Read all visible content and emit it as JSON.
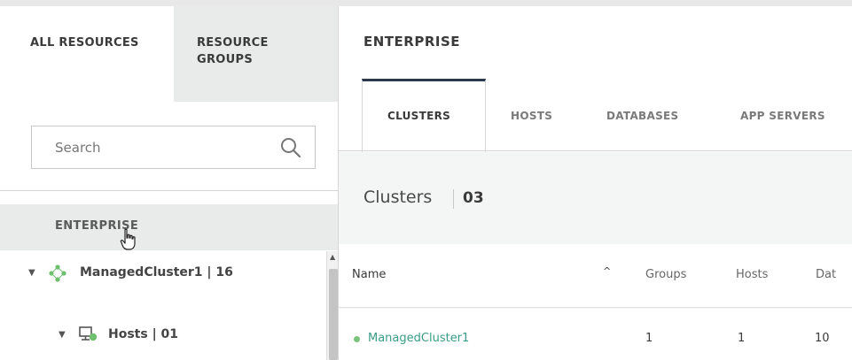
{
  "left_panel": {
    "tabs": [
      {
        "label": "ALL RESOURCES"
      },
      {
        "label": "RESOURCE GROUPS"
      }
    ],
    "search": {
      "placeholder": "Search",
      "value": ""
    },
    "enterprise_label": "ENTERPRISE",
    "tree": [
      {
        "label": "ManagedCluster1 | 16",
        "icon": "cluster-icon"
      },
      {
        "label": "Hosts | 01",
        "icon": "host-icon"
      }
    ]
  },
  "main": {
    "title": "ENTERPRISE",
    "tabs": [
      {
        "label": "CLUSTERS",
        "active": true
      },
      {
        "label": "HOSTS"
      },
      {
        "label": "DATABASES"
      },
      {
        "label": "APP SERVERS"
      }
    ],
    "section": {
      "label": "Clusters",
      "count": "03"
    },
    "table": {
      "columns": [
        "Name",
        "Groups",
        "Hosts",
        "Dat"
      ],
      "rows": [
        {
          "name": "ManagedCluster1",
          "groups": "1",
          "hosts": "1",
          "databases": "10",
          "status_color": "#7cc47c"
        }
      ]
    }
  },
  "colors": {
    "accent_dark": "#2b3a4a",
    "link": "#3a9c86",
    "status_ok": "#7cc47c",
    "cluster_icon": "#6ec06e"
  }
}
